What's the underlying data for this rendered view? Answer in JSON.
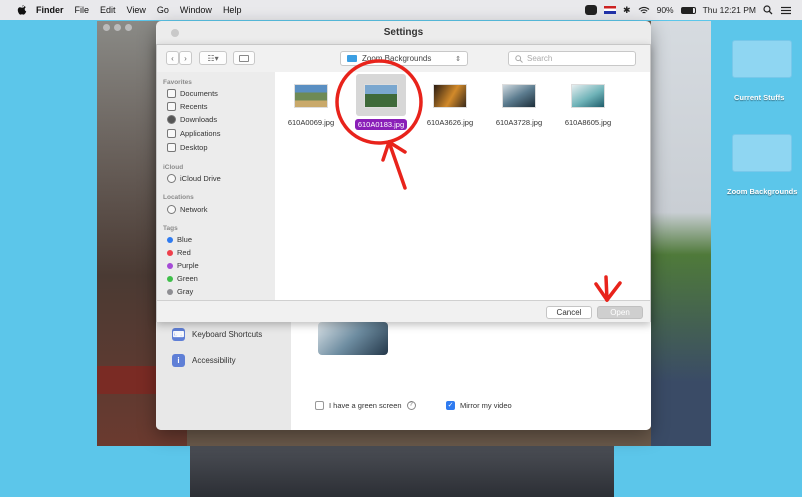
{
  "menubar": {
    "app": "Finder",
    "items": [
      "File",
      "Edit",
      "View",
      "Go",
      "Window",
      "Help"
    ],
    "battery": "90%",
    "clock": "Thu 12:21 PM"
  },
  "desktop": {
    "folders": [
      "Current Stuffs",
      "Zoom Backgrounds"
    ]
  },
  "settings": {
    "title": "Settings",
    "side_items": [
      "Keyboard Shortcuts",
      "Accessibility"
    ],
    "green_screen_label": "I have a green screen",
    "mirror_label": "Mirror my video"
  },
  "dialog": {
    "folder": "Zoom Backgrounds",
    "search_placeholder": "Search",
    "sidebar": {
      "favorites_label": "Favorites",
      "favorites": [
        "Documents",
        "Recents",
        "Downloads",
        "Applications",
        "Desktop"
      ],
      "icloud_label": "iCloud",
      "icloud": [
        "iCloud Drive"
      ],
      "locations_label": "Locations",
      "locations": [
        "Network"
      ],
      "tags_label": "Tags",
      "tags": [
        "Blue",
        "Red",
        "Purple",
        "Green",
        "Gray"
      ]
    },
    "tag_colors": [
      "#2f7bf0",
      "#ee3f4b",
      "#a54bd6",
      "#3fbf4a",
      "#8e8e93"
    ],
    "files": [
      "610A0069.jpg",
      "610A0183.jpg",
      "610A3626.jpg",
      "610A3728.jpg",
      "610A8605.jpg"
    ],
    "selected_file": "610A0183.jpg",
    "cancel_label": "Cancel",
    "open_label": "Open"
  },
  "colors": {
    "selection": "#8a1fb8",
    "annotation": "#e8231b",
    "desktop": "#5cc6ea"
  }
}
